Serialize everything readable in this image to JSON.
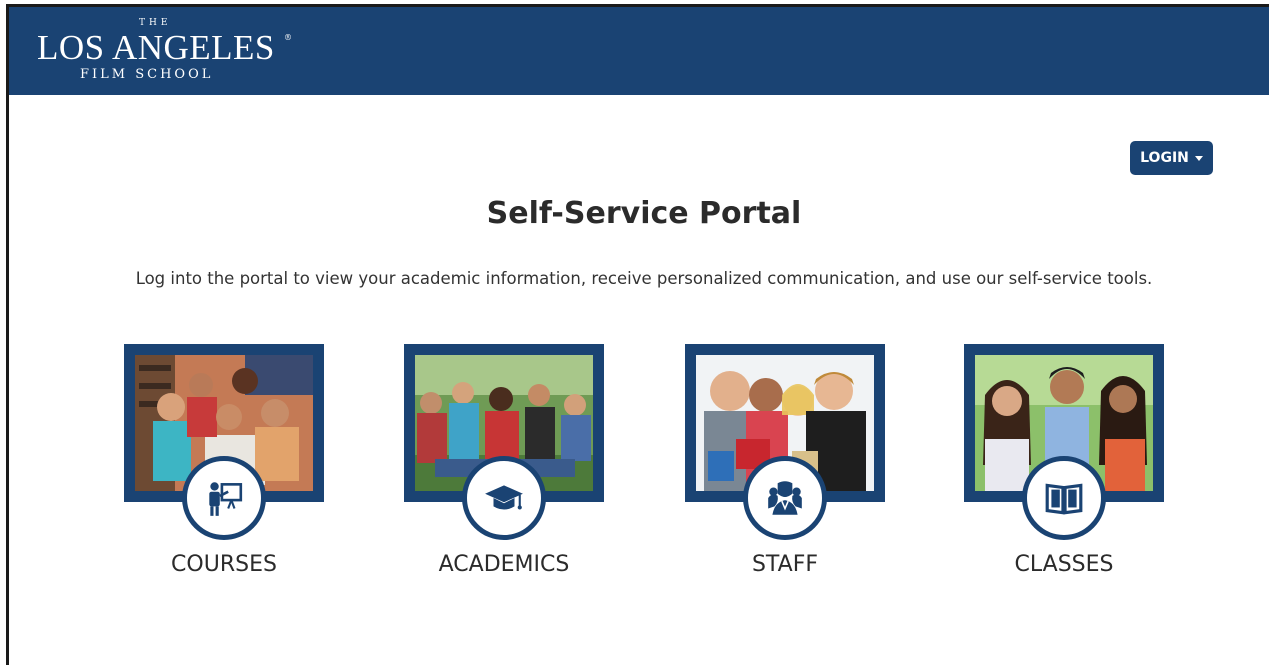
{
  "header": {
    "logo_the": "THE",
    "logo_main": "LOS ANGELES",
    "logo_reg": "®",
    "logo_sub": "FILM SCHOOL"
  },
  "login": {
    "label": "LOGIN"
  },
  "main": {
    "title": "Self-Service Portal",
    "subtitle": "Log into the portal to view your academic information, receive personalized communication, and use our self-service tools."
  },
  "tiles": [
    {
      "label": "COURSES",
      "icon": "presentation-icon"
    },
    {
      "label": "ACADEMICS",
      "icon": "graduation-cap-icon"
    },
    {
      "label": "STAFF",
      "icon": "users-icon"
    },
    {
      "label": "CLASSES",
      "icon": "book-icon"
    }
  ],
  "colors": {
    "brand": "#1a4373",
    "text": "#2b2b2b",
    "background": "#ffffff"
  }
}
